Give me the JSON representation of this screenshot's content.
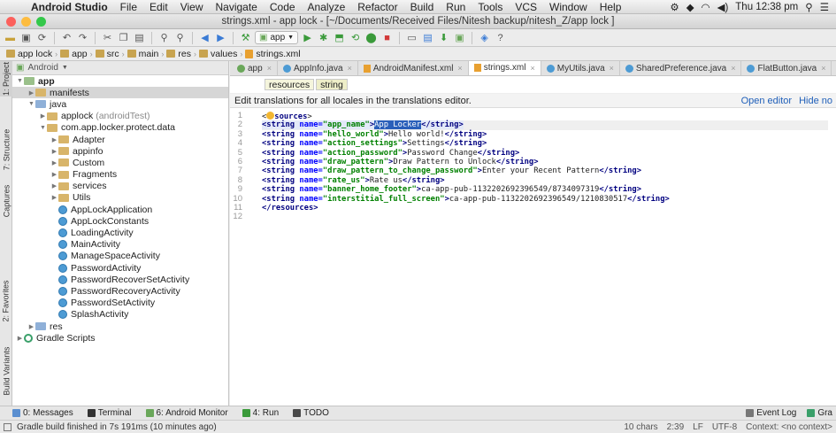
{
  "menubar": {
    "app_name": "Android Studio",
    "menus": [
      "File",
      "Edit",
      "View",
      "Navigate",
      "Code",
      "Analyze",
      "Refactor",
      "Build",
      "Run",
      "Tools",
      "VCS",
      "Window",
      "Help"
    ],
    "clock": "Thu 12:38 pm"
  },
  "window": {
    "title": "strings.xml - app lock - [~/Documents/Received Files/Nitesh backup/nitesh_Z/app lock ]"
  },
  "toolbar": {
    "run_config": "app"
  },
  "breadcrumb": [
    "app lock",
    "app",
    "src",
    "main",
    "res",
    "values",
    "strings.xml"
  ],
  "left_strip": [
    "1: Project",
    "7: Structure",
    "Captures",
    "2: Favorites",
    "Build Variants"
  ],
  "project": {
    "view_mode": "Android",
    "tree": [
      {
        "label": "app",
        "depth": 0,
        "arrow": "▼",
        "icon": "folder"
      },
      {
        "label": "manifests",
        "depth": 1,
        "arrow": "▶",
        "icon": "folder"
      },
      {
        "label": "java",
        "depth": 1,
        "arrow": "▼",
        "icon": "folder"
      },
      {
        "label": "applock",
        "extra": "(androidTest)",
        "depth": 2,
        "arrow": "▶",
        "icon": "folder"
      },
      {
        "label": "com.app.locker.protect.data",
        "depth": 2,
        "arrow": "▼",
        "icon": "folder"
      },
      {
        "label": "Adapter",
        "depth": 3,
        "arrow": "▶",
        "icon": "folder"
      },
      {
        "label": "appinfo",
        "depth": 3,
        "arrow": "▶",
        "icon": "folder"
      },
      {
        "label": "Custom",
        "depth": 3,
        "arrow": "▶",
        "icon": "folder"
      },
      {
        "label": "Fragments",
        "depth": 3,
        "arrow": "▶",
        "icon": "folder"
      },
      {
        "label": "services",
        "depth": 3,
        "arrow": "▶",
        "icon": "folder"
      },
      {
        "label": "Utils",
        "depth": 3,
        "arrow": "▶",
        "icon": "folder"
      },
      {
        "label": "AppLockApplication",
        "depth": 3,
        "arrow": "",
        "icon": "class"
      },
      {
        "label": "AppLockConstants",
        "depth": 3,
        "arrow": "",
        "icon": "class"
      },
      {
        "label": "LoadingActivity",
        "depth": 3,
        "arrow": "",
        "icon": "class"
      },
      {
        "label": "MainActivity",
        "depth": 3,
        "arrow": "",
        "icon": "class"
      },
      {
        "label": "ManageSpaceActivity",
        "depth": 3,
        "arrow": "",
        "icon": "class"
      },
      {
        "label": "PasswordActivity",
        "depth": 3,
        "arrow": "",
        "icon": "class"
      },
      {
        "label": "PasswordRecoverSetActivity",
        "depth": 3,
        "arrow": "",
        "icon": "class"
      },
      {
        "label": "PasswordRecoveryActivity",
        "depth": 3,
        "arrow": "",
        "icon": "class"
      },
      {
        "label": "PasswordSetActivity",
        "depth": 3,
        "arrow": "",
        "icon": "class"
      },
      {
        "label": "SplashActivity",
        "depth": 3,
        "arrow": "",
        "icon": "class"
      },
      {
        "label": "res",
        "depth": 1,
        "arrow": "▶",
        "icon": "folder"
      },
      {
        "label": "Gradle Scripts",
        "depth": 0,
        "arrow": "▶",
        "icon": "gradle"
      }
    ]
  },
  "editor_tabs": [
    {
      "label": "app",
      "icon": "android"
    },
    {
      "label": "AppInfo.java",
      "icon": "class"
    },
    {
      "label": "AndroidManifest.xml",
      "icon": "xml"
    },
    {
      "label": "strings.xml",
      "icon": "xml",
      "active": true
    },
    {
      "label": "MyUtils.java",
      "icon": "class"
    },
    {
      "label": "SharedPreference.java",
      "icon": "class"
    },
    {
      "label": "FlatButton.java",
      "icon": "class"
    }
  ],
  "editor": {
    "tag_path": [
      "resources",
      "string"
    ],
    "notice": "Edit translations for all locales in the translations editor.",
    "open_editor": "Open editor",
    "hide_notification": "Hide no",
    "line_numbers": [
      "1",
      "2",
      "3",
      "4",
      "5",
      "6",
      "7",
      "8",
      "9",
      "10",
      "11",
      "12"
    ]
  },
  "bottom_tabs": [
    "0: Messages",
    "Terminal",
    "6: Android Monitor",
    "4: Run",
    "TODO"
  ],
  "bottom_right": [
    "Event Log",
    "Gra"
  ],
  "status": {
    "message": "Gradle build finished in 7s 191ms (10 minutes ago)",
    "chars": "10 chars",
    "position": "2:39",
    "line_sep": "LF",
    "encoding": "UTF-8",
    "context": "Context: <no context>"
  }
}
